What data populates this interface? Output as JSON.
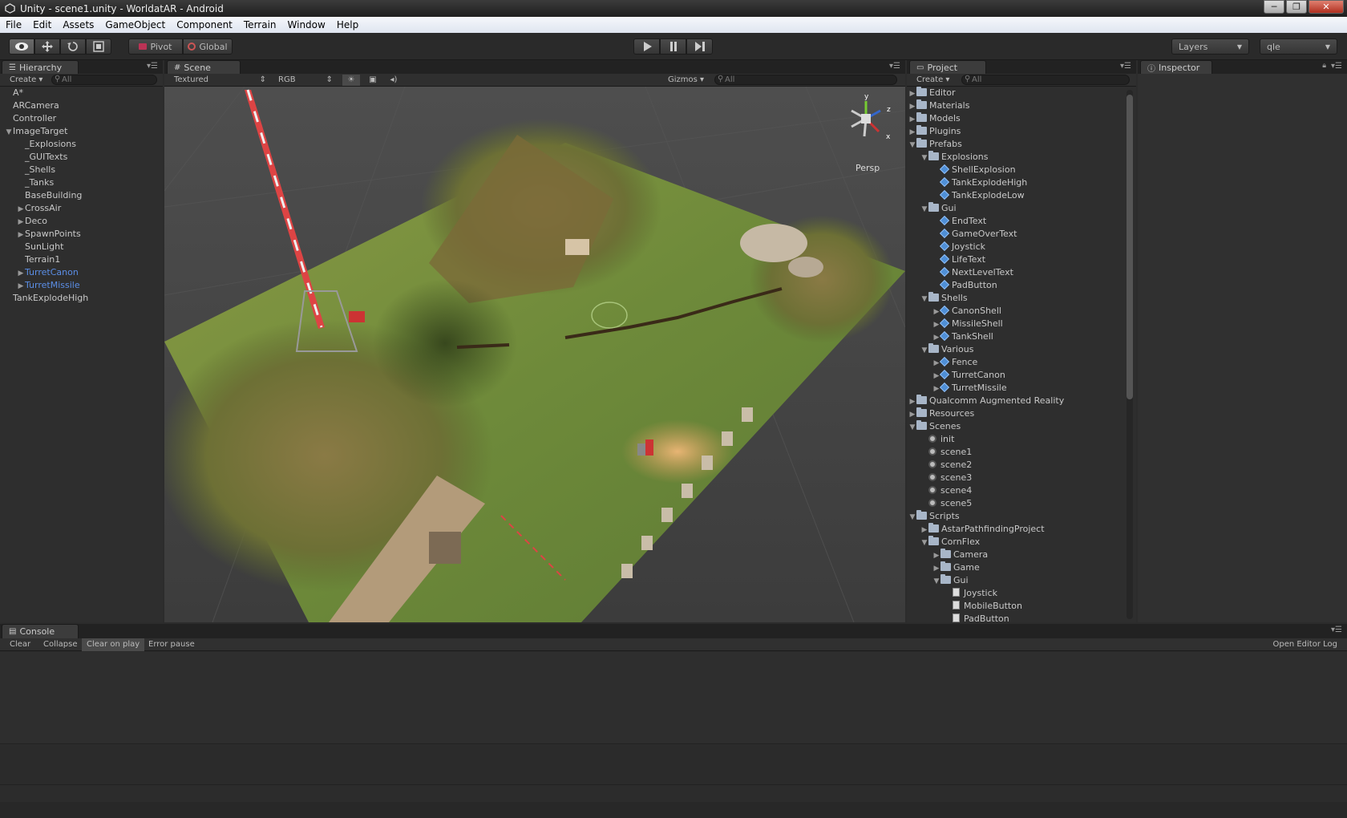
{
  "window": {
    "title": "Unity - scene1.unity - WorldatAR - Android",
    "controls": [
      "─",
      "❐",
      "✕"
    ]
  },
  "menu": [
    "File",
    "Edit",
    "Assets",
    "GameObject",
    "Component",
    "Terrain",
    "Window",
    "Help"
  ],
  "toolbar": {
    "pivot": "Pivot",
    "global": "Global",
    "layers": "Layers",
    "layout": "qle"
  },
  "hierarchy": {
    "tab": "Hierarchy",
    "create": "Create",
    "search": "All",
    "items": [
      {
        "label": "A*",
        "indent": 0,
        "arrow": "",
        "prefab": false
      },
      {
        "label": "ARCamera",
        "indent": 0,
        "arrow": "",
        "prefab": false
      },
      {
        "label": "Controller",
        "indent": 0,
        "arrow": "",
        "prefab": false
      },
      {
        "label": "ImageTarget",
        "indent": 0,
        "arrow": "▼",
        "prefab": false
      },
      {
        "label": "_Explosions",
        "indent": 1,
        "arrow": "",
        "prefab": false
      },
      {
        "label": "_GUITexts",
        "indent": 1,
        "arrow": "",
        "prefab": false
      },
      {
        "label": "_Shells",
        "indent": 1,
        "arrow": "",
        "prefab": false
      },
      {
        "label": "_Tanks",
        "indent": 1,
        "arrow": "",
        "prefab": false
      },
      {
        "label": "BaseBuilding",
        "indent": 1,
        "arrow": "",
        "prefab": false
      },
      {
        "label": "CrossAir",
        "indent": 1,
        "arrow": "▶",
        "prefab": false
      },
      {
        "label": "Deco",
        "indent": 1,
        "arrow": "▶",
        "prefab": false
      },
      {
        "label": "SpawnPoints",
        "indent": 1,
        "arrow": "▶",
        "prefab": false
      },
      {
        "label": "SunLight",
        "indent": 1,
        "arrow": "",
        "prefab": false
      },
      {
        "label": "Terrain1",
        "indent": 1,
        "arrow": "",
        "prefab": false
      },
      {
        "label": "TurretCanon",
        "indent": 1,
        "arrow": "▶",
        "prefab": true
      },
      {
        "label": "TurretMissile",
        "indent": 1,
        "arrow": "▶",
        "prefab": true
      },
      {
        "label": "TankExplodeHigh",
        "indent": 0,
        "arrow": "",
        "prefab": false
      }
    ]
  },
  "scene": {
    "tab": "Scene",
    "render_mode": "Textured",
    "channel": "RGB",
    "gizmos": "Gizmos",
    "search": "All",
    "persp": "Persp",
    "axis_x": "x",
    "axis_y": "y",
    "axis_z": "z"
  },
  "project": {
    "tab": "Project",
    "create": "Create",
    "search": "All",
    "items": [
      {
        "label": "Editor",
        "indent": 0,
        "arrow": "▶",
        "icon": "folder"
      },
      {
        "label": "Materials",
        "indent": 0,
        "arrow": "▶",
        "icon": "folder"
      },
      {
        "label": "Models",
        "indent": 0,
        "arrow": "▶",
        "icon": "folder"
      },
      {
        "label": "Plugins",
        "indent": 0,
        "arrow": "▶",
        "icon": "folder"
      },
      {
        "label": "Prefabs",
        "indent": 0,
        "arrow": "▼",
        "icon": "folder"
      },
      {
        "label": "Explosions",
        "indent": 1,
        "arrow": "▼",
        "icon": "folder"
      },
      {
        "label": "ShellExplosion",
        "indent": 2,
        "arrow": "",
        "icon": "prefab"
      },
      {
        "label": "TankExplodeHigh",
        "indent": 2,
        "arrow": "",
        "icon": "prefab"
      },
      {
        "label": "TankExplodeLow",
        "indent": 2,
        "arrow": "",
        "icon": "prefab"
      },
      {
        "label": "Gui",
        "indent": 1,
        "arrow": "▼",
        "icon": "folder"
      },
      {
        "label": "EndText",
        "indent": 2,
        "arrow": "",
        "icon": "prefab"
      },
      {
        "label": "GameOverText",
        "indent": 2,
        "arrow": "",
        "icon": "prefab"
      },
      {
        "label": "Joystick",
        "indent": 2,
        "arrow": "",
        "icon": "prefab"
      },
      {
        "label": "LifeText",
        "indent": 2,
        "arrow": "",
        "icon": "prefab"
      },
      {
        "label": "NextLevelText",
        "indent": 2,
        "arrow": "",
        "icon": "prefab"
      },
      {
        "label": "PadButton",
        "indent": 2,
        "arrow": "",
        "icon": "prefab"
      },
      {
        "label": "Shells",
        "indent": 1,
        "arrow": "▼",
        "icon": "folder"
      },
      {
        "label": "CanonShell",
        "indent": 2,
        "arrow": "▶",
        "icon": "prefab"
      },
      {
        "label": "MissileShell",
        "indent": 2,
        "arrow": "▶",
        "icon": "prefab"
      },
      {
        "label": "TankShell",
        "indent": 2,
        "arrow": "▶",
        "icon": "prefab"
      },
      {
        "label": "Various",
        "indent": 1,
        "arrow": "▼",
        "icon": "folder"
      },
      {
        "label": "Fence",
        "indent": 2,
        "arrow": "▶",
        "icon": "prefab"
      },
      {
        "label": "TurretCanon",
        "indent": 2,
        "arrow": "▶",
        "icon": "prefab"
      },
      {
        "label": "TurretMissile",
        "indent": 2,
        "arrow": "▶",
        "icon": "prefab"
      },
      {
        "label": "Qualcomm Augmented Reality",
        "indent": 0,
        "arrow": "▶",
        "icon": "folder"
      },
      {
        "label": "Resources",
        "indent": 0,
        "arrow": "▶",
        "icon": "folder"
      },
      {
        "label": "Scenes",
        "indent": 0,
        "arrow": "▼",
        "icon": "folder"
      },
      {
        "label": "init",
        "indent": 1,
        "arrow": "",
        "icon": "scene"
      },
      {
        "label": "scene1",
        "indent": 1,
        "arrow": "",
        "icon": "scene"
      },
      {
        "label": "scene2",
        "indent": 1,
        "arrow": "",
        "icon": "scene"
      },
      {
        "label": "scene3",
        "indent": 1,
        "arrow": "",
        "icon": "scene"
      },
      {
        "label": "scene4",
        "indent": 1,
        "arrow": "",
        "icon": "scene"
      },
      {
        "label": "scene5",
        "indent": 1,
        "arrow": "",
        "icon": "scene"
      },
      {
        "label": "Scripts",
        "indent": 0,
        "arrow": "▼",
        "icon": "folder"
      },
      {
        "label": "AstarPathfindingProject",
        "indent": 1,
        "arrow": "▶",
        "icon": "folder"
      },
      {
        "label": "CornFlex",
        "indent": 1,
        "arrow": "▼",
        "icon": "folder"
      },
      {
        "label": "Camera",
        "indent": 2,
        "arrow": "▶",
        "icon": "folder"
      },
      {
        "label": "Game",
        "indent": 2,
        "arrow": "▶",
        "icon": "folder"
      },
      {
        "label": "Gui",
        "indent": 2,
        "arrow": "▼",
        "icon": "folder"
      },
      {
        "label": "Joystick",
        "indent": 3,
        "arrow": "",
        "icon": "script"
      },
      {
        "label": "MobileButton",
        "indent": 3,
        "arrow": "",
        "icon": "script"
      },
      {
        "label": "PadButton",
        "indent": 3,
        "arrow": "",
        "icon": "script"
      }
    ]
  },
  "inspector": {
    "tab": "Inspector"
  },
  "console": {
    "tab": "Console",
    "clear": "Clear",
    "collapse": "Collapse",
    "clear_on_play": "Clear on play",
    "error_pause": "Error pause",
    "open_log": "Open Editor Log"
  }
}
